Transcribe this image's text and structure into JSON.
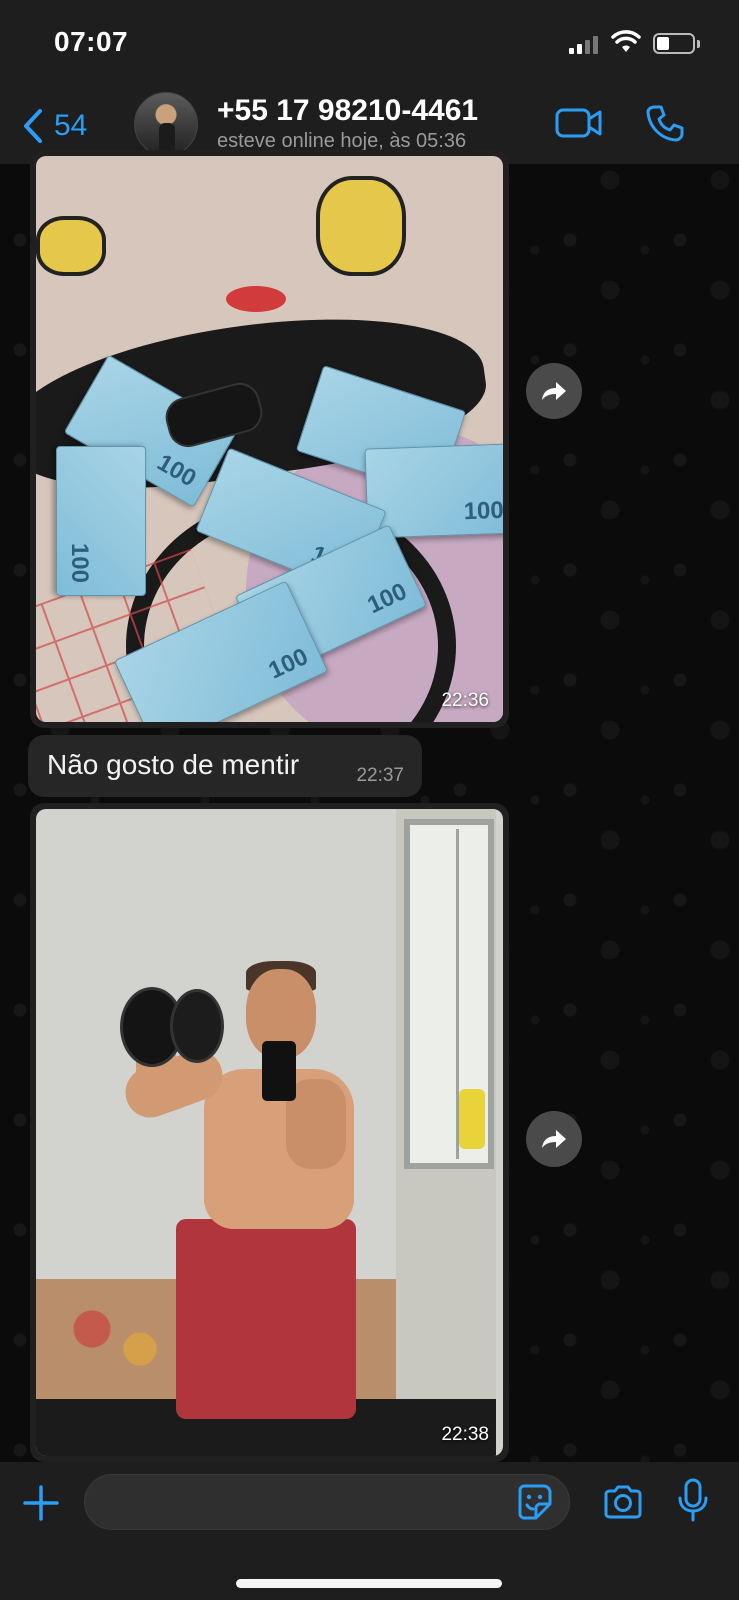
{
  "status_bar": {
    "time": "07:07"
  },
  "header": {
    "back_count": "54",
    "contact_name": "+55 17 98210-4461",
    "contact_status": "esteve online hoje, às 05:36",
    "accent_color": "#2a9df4"
  },
  "messages": [
    {
      "type": "image",
      "time": "22:36"
    },
    {
      "type": "text",
      "text": "Não gosto de mentir",
      "time": "22:37"
    },
    {
      "type": "image",
      "time": "22:38"
    }
  ],
  "composer": {
    "placeholder": ""
  },
  "icons": {
    "back": "chevron-left-icon",
    "video": "video-camera-icon",
    "call": "phone-icon",
    "forward": "forward-arrow-icon",
    "attach": "plus-icon",
    "sticker": "sticker-icon",
    "camera": "camera-icon",
    "mic": "microphone-icon"
  }
}
